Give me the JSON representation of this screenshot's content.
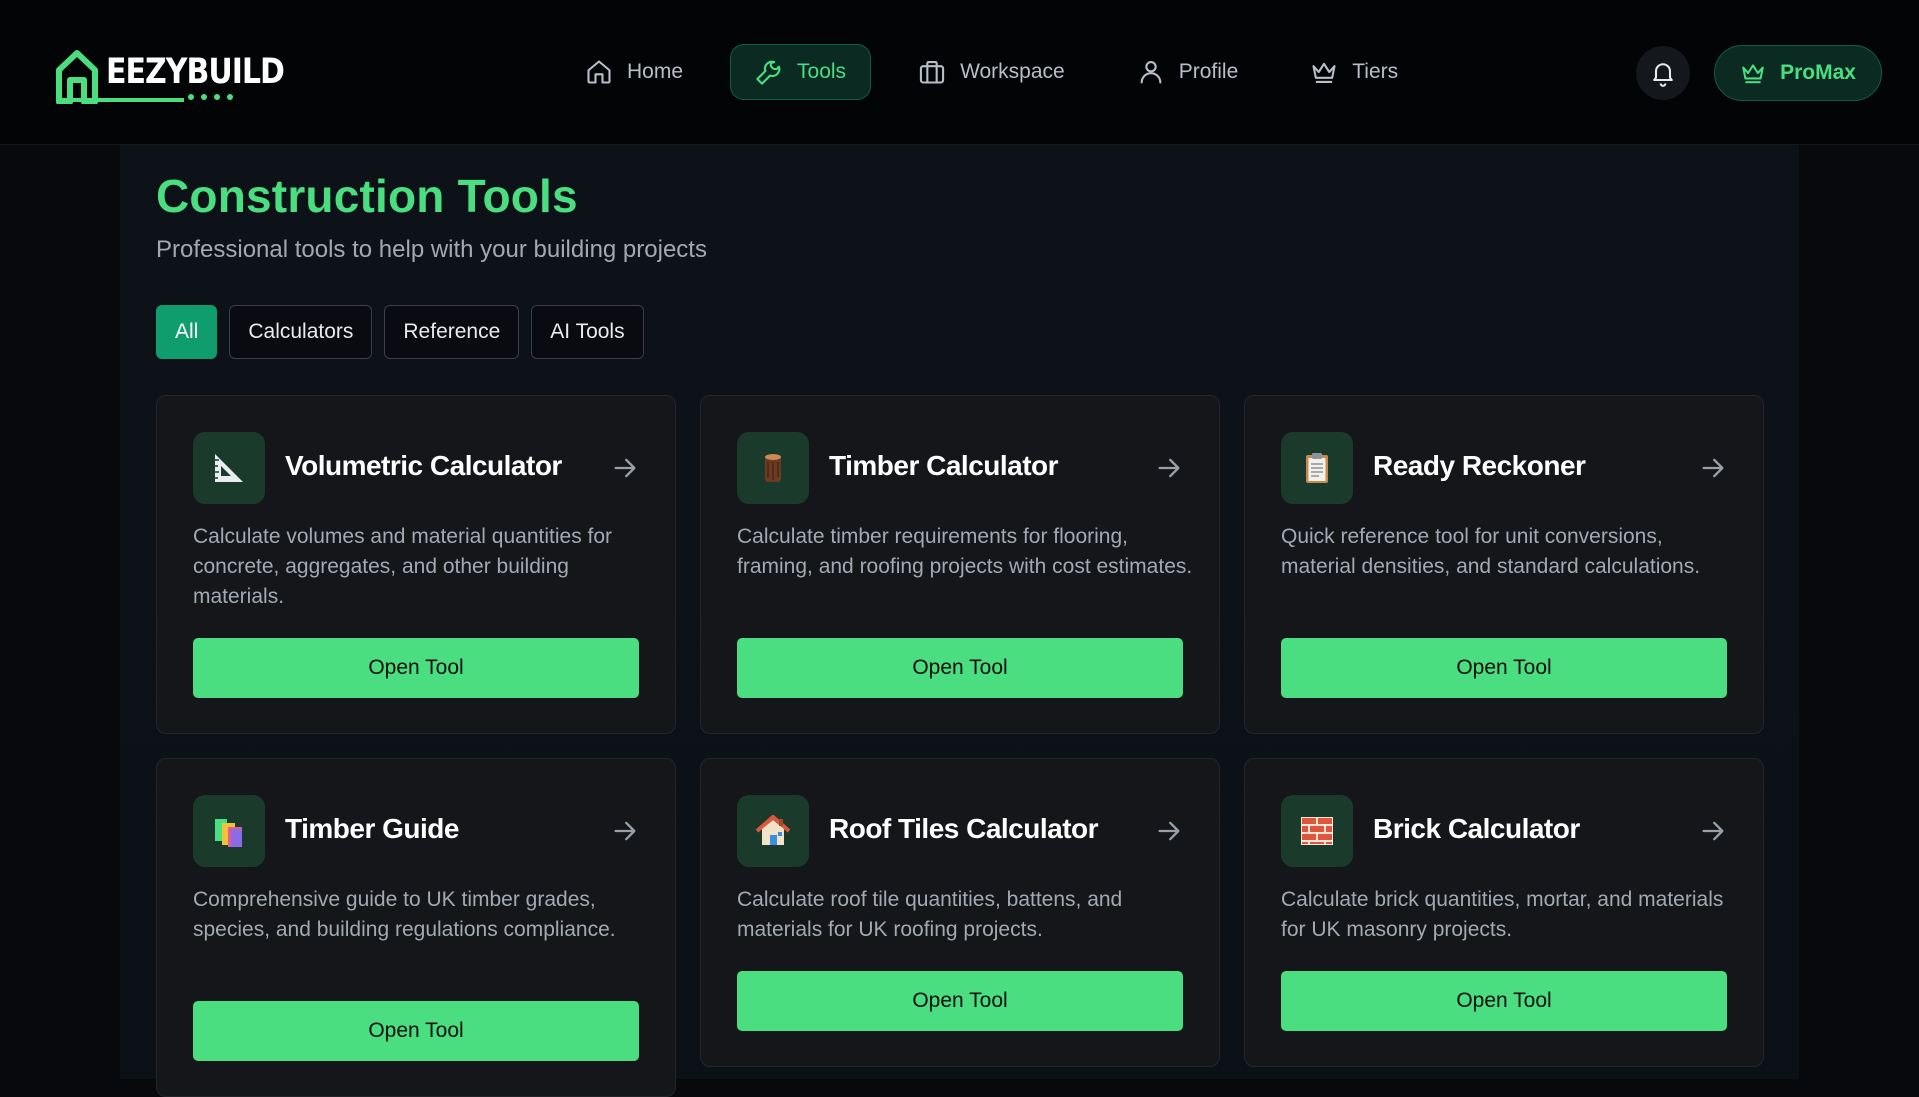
{
  "brand": {
    "name": "EEZYBUILD",
    "accent": "#4ade80"
  },
  "nav": {
    "items": [
      {
        "label": "Home",
        "icon": "home-icon"
      },
      {
        "label": "Tools",
        "icon": "wrench-icon",
        "active": true
      },
      {
        "label": "Workspace",
        "icon": "briefcase-icon"
      },
      {
        "label": "Profile",
        "icon": "user-icon"
      },
      {
        "label": "Tiers",
        "icon": "crown-icon"
      }
    ],
    "notifications_icon": "bell-icon",
    "plan_label": "ProMax"
  },
  "page": {
    "title": "Construction Tools",
    "subtitle": "Professional tools to help with your building projects"
  },
  "filters": [
    {
      "label": "All",
      "active": true
    },
    {
      "label": "Calculators"
    },
    {
      "label": "Reference"
    },
    {
      "label": "AI Tools"
    }
  ],
  "tools": [
    {
      "title": "Volumetric Calculator",
      "icon": "triangle-ruler-icon",
      "description": "Calculate volumes and material quantities for concrete, aggregates, and other building materials.",
      "button": "Open Tool"
    },
    {
      "title": "Timber Calculator",
      "icon": "wood-log-icon",
      "description": "Calculate timber requirements for flooring, framing, and roofing projects with cost estimates.",
      "button": "Open Tool"
    },
    {
      "title": "Ready Reckoner",
      "icon": "clipboard-icon",
      "description": "Quick reference tool for unit conversions, material densities, and standard calculations.",
      "button": "Open Tool"
    },
    {
      "title": "Timber Guide",
      "icon": "books-icon",
      "description": "Comprehensive guide to UK timber grades, species, and building regulations compliance.",
      "button": "Open Tool"
    },
    {
      "title": "Roof Tiles Calculator",
      "icon": "house-icon",
      "description": "Calculate roof tile quantities, battens, and materials for UK roofing projects.",
      "button": "Open Tool"
    },
    {
      "title": "Brick Calculator",
      "icon": "brick-icon",
      "description": "Calculate brick quantities, mortar, and materials for UK masonry projects.",
      "button": "Open Tool"
    }
  ]
}
